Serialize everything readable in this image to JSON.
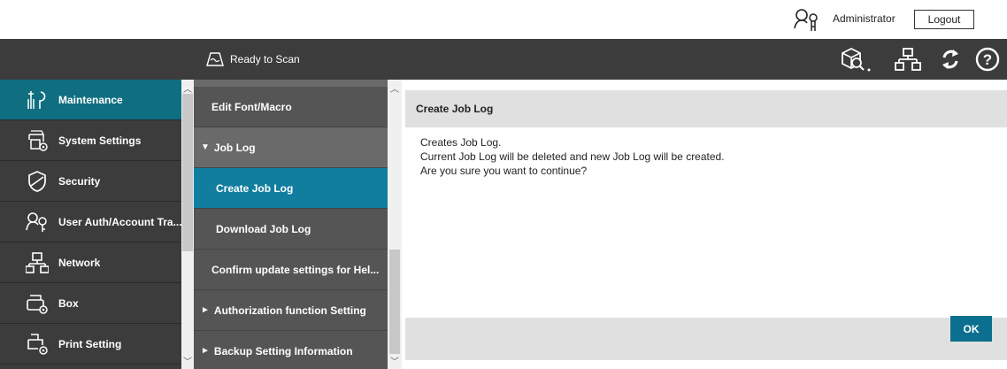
{
  "user": {
    "name": "Administrator",
    "logout_label": "Logout"
  },
  "header": {
    "status_text": "Ready to Scan",
    "icons": [
      "device-search-icon",
      "network-icon",
      "refresh-icon",
      "help-icon"
    ]
  },
  "leftnav": {
    "items": [
      {
        "label": "Maintenance",
        "icon": "maintenance-icon",
        "active": true
      },
      {
        "label": "System Settings",
        "icon": "system-settings-icon"
      },
      {
        "label": "Security",
        "icon": "security-icon"
      },
      {
        "label": "User Auth/Account Tra...",
        "icon": "user-auth-icon"
      },
      {
        "label": "Network",
        "icon": "network-icon"
      },
      {
        "label": "Box",
        "icon": "box-icon"
      },
      {
        "label": "Print Setting",
        "icon": "print-setting-icon"
      }
    ]
  },
  "subnav": {
    "items": [
      {
        "label": "Edit Font/Macro"
      },
      {
        "label": "Job Log",
        "prefix": "▼",
        "expanded": true
      },
      {
        "label": "Create Job Log",
        "active": true
      },
      {
        "label": "Download Job Log"
      },
      {
        "label": "Confirm update settings for Hel..."
      },
      {
        "label": "Authorization function Setting",
        "prefix": "►"
      },
      {
        "label": "Backup Setting Information",
        "prefix": "►"
      }
    ]
  },
  "content": {
    "title": "Create Job Log",
    "lines": [
      "Creates Job Log.",
      "Current Job Log will be deleted and new Job Log will be created.",
      "Are you sure you want to continue?"
    ],
    "ok_label": "OK"
  },
  "colors": {
    "header_bg": "#3c3c3c",
    "nav_active": "#0f6f80",
    "sub_active": "#117ea0",
    "ok_button": "#0c6f8f"
  }
}
